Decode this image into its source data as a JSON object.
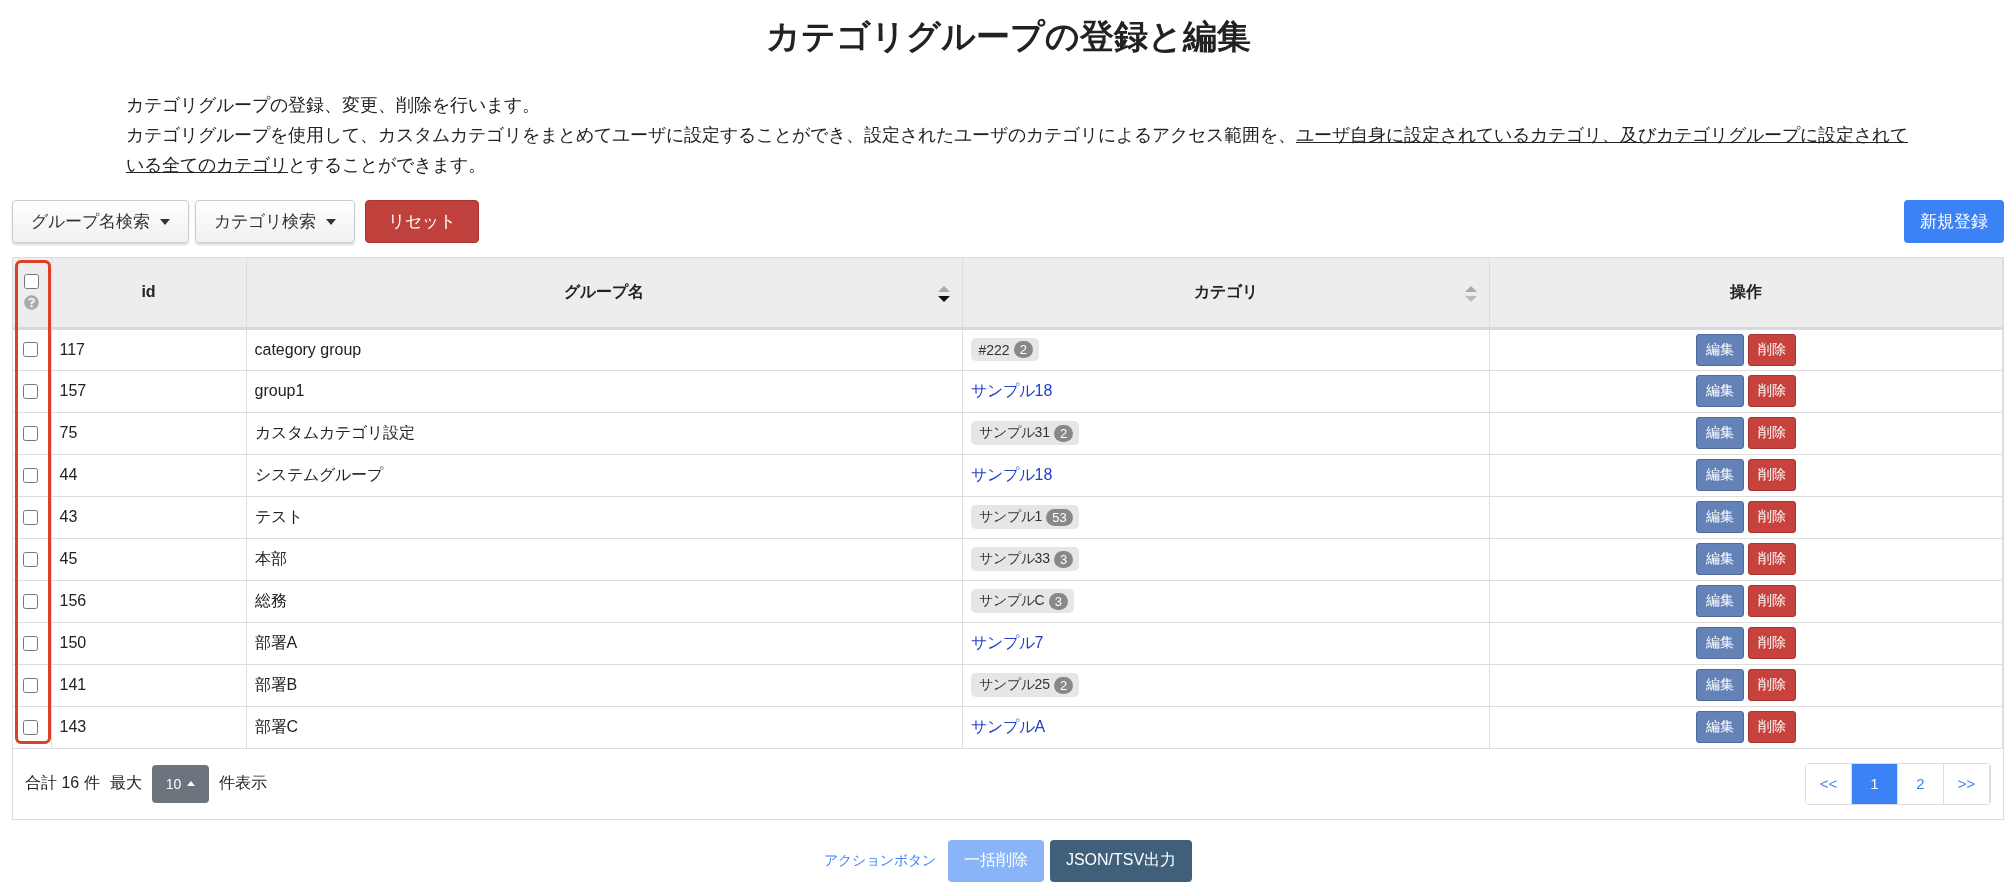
{
  "title": "カテゴリグループの登録と編集",
  "description": {
    "line1": "カテゴリグループの登録、変更、削除を行います。",
    "line2_parts": [
      {
        "text": "カテゴリグループを使用して、カスタムカテゴリをまとめてユーザに設定することができ、設定されたユーザのカテゴリによるアクセス範囲を、",
        "underline": false
      },
      {
        "text": "ユーザ自身に設定されているカテゴリ、及びカテゴリグループに設定されている全てのカテゴリ",
        "underline": true
      },
      {
        "text": "とすることができます。",
        "underline": false
      }
    ]
  },
  "toolbar": {
    "filters": [
      "グループ名検索",
      "カテゴリ検索"
    ],
    "reset": "リセット",
    "create": "新規登録"
  },
  "table": {
    "select_all": {
      "checked": false
    },
    "columns": [
      {
        "label": "id"
      },
      {
        "label": "グループ名",
        "sorted_descending": true
      },
      {
        "label": "カテゴリ",
        "sorted_descending": false
      },
      {
        "label": "操作"
      }
    ],
    "rows": [
      {
        "checked": false,
        "id": "117",
        "name": "category group",
        "category": {
          "kind": "tag",
          "label": "#222",
          "count": "2"
        }
      },
      {
        "checked": false,
        "id": "157",
        "name": "group1",
        "category": {
          "kind": "link",
          "label": "サンプル18"
        }
      },
      {
        "checked": false,
        "id": "75",
        "name": "カスタムカテゴリ設定",
        "category": {
          "kind": "tag",
          "label": "サンプル31",
          "count": "2"
        }
      },
      {
        "checked": false,
        "id": "44",
        "name": "システムグループ",
        "category": {
          "kind": "link",
          "label": "サンプル18"
        }
      },
      {
        "checked": false,
        "id": "43",
        "name": "テスト",
        "category": {
          "kind": "tag",
          "label": "サンプル1",
          "count": "53"
        }
      },
      {
        "checked": false,
        "id": "45",
        "name": "本部",
        "category": {
          "kind": "tag",
          "label": "サンプル33",
          "count": "3"
        }
      },
      {
        "checked": false,
        "id": "156",
        "name": "総務",
        "category": {
          "kind": "tag",
          "label": "サンプルC",
          "count": "3"
        }
      },
      {
        "checked": false,
        "id": "150",
        "name": "部署A",
        "category": {
          "kind": "link",
          "label": "サンプル7"
        }
      },
      {
        "checked": false,
        "id": "141",
        "name": "部署B",
        "category": {
          "kind": "tag",
          "label": "サンプル25",
          "count": "2"
        }
      },
      {
        "checked": false,
        "id": "143",
        "name": "部署C",
        "category": {
          "kind": "link",
          "label": "サンプルA"
        }
      }
    ],
    "row_actions": [
      {
        "edit": "編集",
        "delete": "削除"
      },
      {
        "edit": "編集",
        "delete": "削除"
      },
      {
        "edit": "編集",
        "delete": "削除"
      },
      {
        "edit": "編集",
        "delete": "削除"
      },
      {
        "edit": "編集",
        "delete": "削除"
      },
      {
        "edit": "編集",
        "delete": "削除"
      },
      {
        "edit": "編集",
        "delete": "削除"
      },
      {
        "edit": "編集",
        "delete": "削除"
      },
      {
        "edit": "編集",
        "delete": "削除"
      },
      {
        "edit": "編集",
        "delete": "削除"
      }
    ]
  },
  "footer": {
    "total": "合計 16 件",
    "max_label": "最大",
    "page_size": "10",
    "per_page_suffix": "件表示",
    "pagination": [
      {
        "label": "<<",
        "selected": false
      },
      {
        "label": "1",
        "selected": true
      },
      {
        "label": "2",
        "selected": false
      },
      {
        "label": ">>",
        "selected": false
      }
    ]
  },
  "actions": {
    "label": "アクションボタン",
    "buttons": [
      {
        "label": "一括削除",
        "disabled": true
      },
      {
        "label": "JSON/TSV出力",
        "disabled": false
      }
    ]
  }
}
